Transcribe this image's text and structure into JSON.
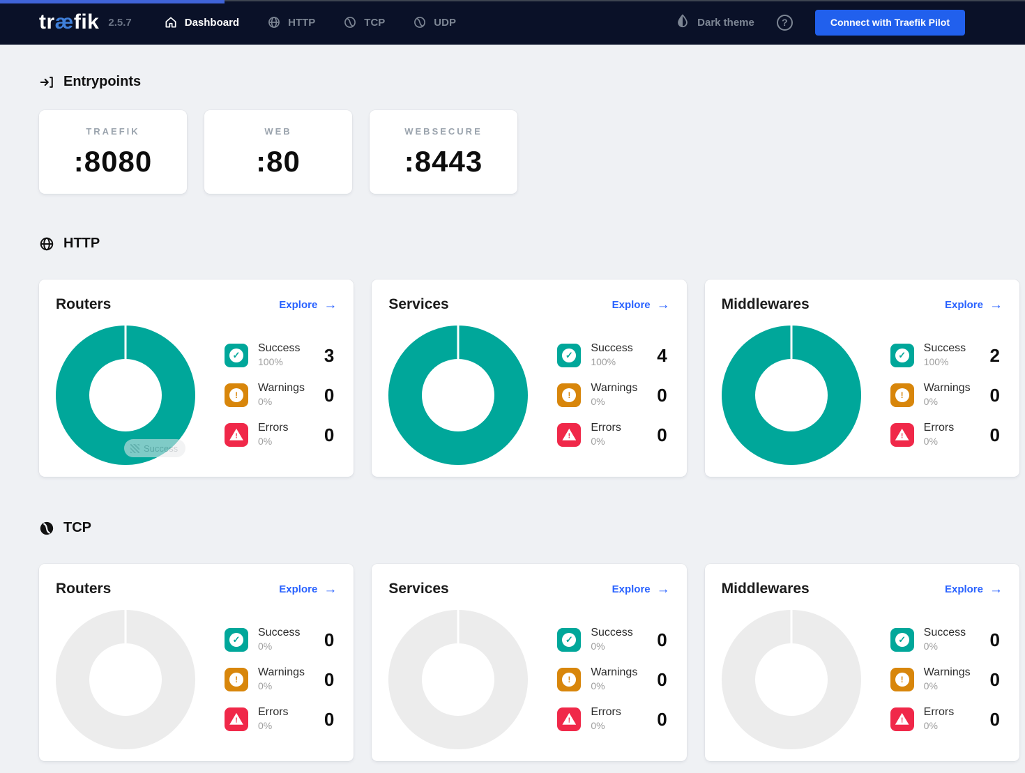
{
  "navbar": {
    "logo_pre": "tr",
    "logo_ae": "æ",
    "logo_post": "fik",
    "version": "2.5.7",
    "items": {
      "dashboard": "Dashboard",
      "http": "HTTP",
      "tcp": "TCP",
      "udp": "UDP"
    },
    "theme_label": "Dark theme",
    "help_label": "?",
    "pilot_button": "Connect with Traefik Pilot"
  },
  "entrypoints": {
    "heading": "Entrypoints",
    "cards": [
      {
        "name": "TRAEFIK",
        "port": ":8080"
      },
      {
        "name": "WEB",
        "port": ":80"
      },
      {
        "name": "WEBSECURE",
        "port": ":8443"
      }
    ]
  },
  "sections": [
    {
      "heading": "HTTP",
      "cards": [
        {
          "title": "Routers",
          "explore_label": "Explore",
          "tooltip": "Success",
          "stats": [
            {
              "label": "Success",
              "pct": "100%",
              "value": "3"
            },
            {
              "label": "Warnings",
              "pct": "0%",
              "value": "0"
            },
            {
              "label": "Errors",
              "pct": "0%",
              "value": "0"
            }
          ]
        },
        {
          "title": "Services",
          "explore_label": "Explore",
          "stats": [
            {
              "label": "Success",
              "pct": "100%",
              "value": "4"
            },
            {
              "label": "Warnings",
              "pct": "0%",
              "value": "0"
            },
            {
              "label": "Errors",
              "pct": "0%",
              "value": "0"
            }
          ]
        },
        {
          "title": "Middlewares",
          "explore_label": "Explore",
          "stats": [
            {
              "label": "Success",
              "pct": "100%",
              "value": "2"
            },
            {
              "label": "Warnings",
              "pct": "0%",
              "value": "0"
            },
            {
              "label": "Errors",
              "pct": "0%",
              "value": "0"
            }
          ]
        }
      ]
    },
    {
      "heading": "TCP",
      "cards": [
        {
          "title": "Routers",
          "explore_label": "Explore",
          "stats": [
            {
              "label": "Success",
              "pct": "0%",
              "value": "0"
            },
            {
              "label": "Warnings",
              "pct": "0%",
              "value": "0"
            },
            {
              "label": "Errors",
              "pct": "0%",
              "value": "0"
            }
          ]
        },
        {
          "title": "Services",
          "explore_label": "Explore",
          "stats": [
            {
              "label": "Success",
              "pct": "0%",
              "value": "0"
            },
            {
              "label": "Warnings",
              "pct": "0%",
              "value": "0"
            },
            {
              "label": "Errors",
              "pct": "0%",
              "value": "0"
            }
          ]
        },
        {
          "title": "Middlewares",
          "explore_label": "Explore",
          "stats": [
            {
              "label": "Success",
              "pct": "0%",
              "value": "0"
            },
            {
              "label": "Warnings",
              "pct": "0%",
              "value": "0"
            },
            {
              "label": "Errors",
              "pct": "0%",
              "value": "0"
            }
          ]
        }
      ]
    }
  ],
  "chart_data": [
    {
      "type": "pie",
      "title": "HTTP Routers",
      "categories": [
        "Success",
        "Warnings",
        "Errors"
      ],
      "values": [
        100,
        0,
        0
      ],
      "counts": [
        3,
        0,
        0
      ]
    },
    {
      "type": "pie",
      "title": "HTTP Services",
      "categories": [
        "Success",
        "Warnings",
        "Errors"
      ],
      "values": [
        100,
        0,
        0
      ],
      "counts": [
        4,
        0,
        0
      ]
    },
    {
      "type": "pie",
      "title": "HTTP Middlewares",
      "categories": [
        "Success",
        "Warnings",
        "Errors"
      ],
      "values": [
        100,
        0,
        0
      ],
      "counts": [
        2,
        0,
        0
      ]
    },
    {
      "type": "pie",
      "title": "TCP Routers",
      "categories": [
        "Success",
        "Warnings",
        "Errors"
      ],
      "values": [
        0,
        0,
        0
      ],
      "counts": [
        0,
        0,
        0
      ]
    },
    {
      "type": "pie",
      "title": "TCP Services",
      "categories": [
        "Success",
        "Warnings",
        "Errors"
      ],
      "values": [
        0,
        0,
        0
      ],
      "counts": [
        0,
        0,
        0
      ]
    },
    {
      "type": "pie",
      "title": "TCP Middlewares",
      "categories": [
        "Success",
        "Warnings",
        "Errors"
      ],
      "values": [
        0,
        0,
        0
      ],
      "counts": [
        0,
        0,
        0
      ]
    }
  ],
  "colors": {
    "navbar_bg": "#0a1128",
    "page_bg": "#eff1f4",
    "progress_bar_blue": "#4064d8",
    "logo_accent_blue": "#3f7fd9",
    "pilot_button_blue": "#2160ed",
    "explore_link_blue": "#2962ff",
    "success_teal": "#00a79a",
    "warning_orange": "#d8860b",
    "error_red": "#f02849",
    "empty_donut_gray": "#ececec"
  }
}
